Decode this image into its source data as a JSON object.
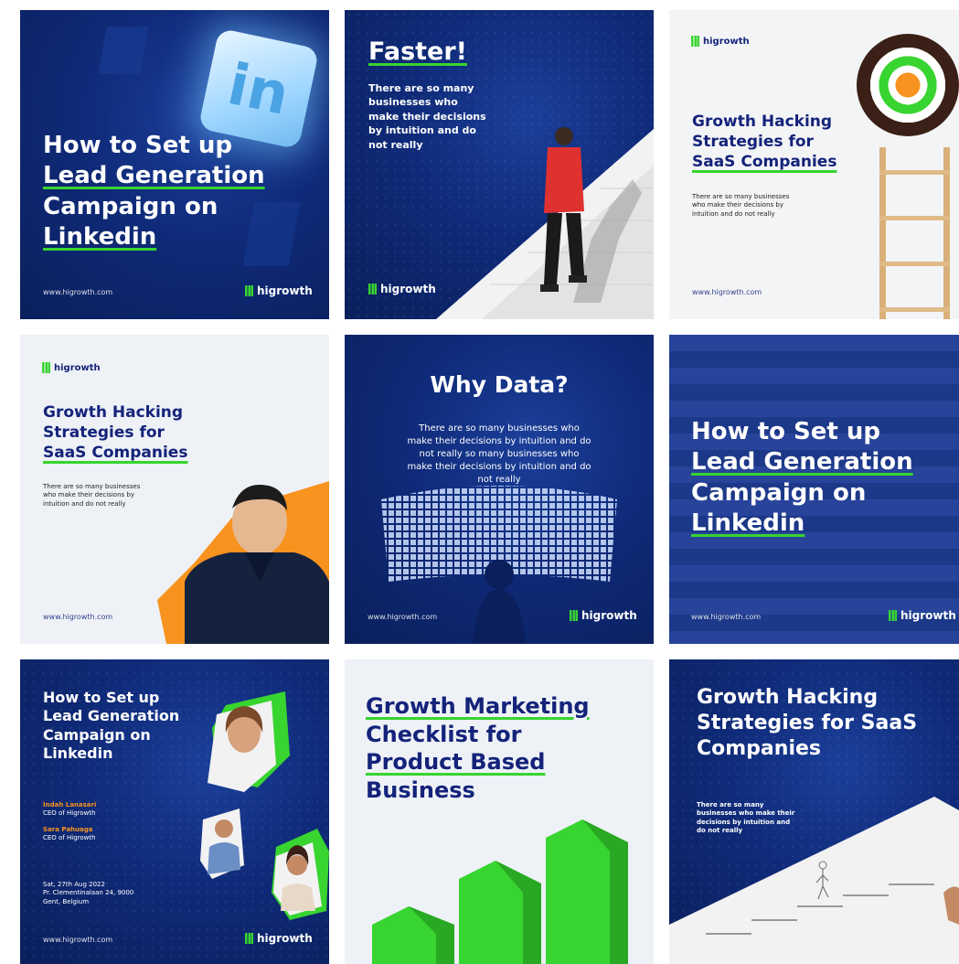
{
  "brand": {
    "name": "higrowth",
    "site": "www.higrowth.com"
  },
  "colors": {
    "navy": "#0f2a78",
    "accent_green": "#38d430",
    "orange": "#f7931e",
    "light_bg": "#eef1f6"
  },
  "tiles": [
    {
      "title_lines": [
        "How to Set up",
        "Lead Generation",
        "Campaign on",
        "Linkedin"
      ],
      "logo_text": "in"
    },
    {
      "heading": "Faster!",
      "body_lines": [
        "There are so many",
        "businesses who",
        "make their decisions",
        "by intuition and do",
        "not really"
      ]
    },
    {
      "title_lines": [
        "Growth Hacking",
        "Strategies for",
        "SaaS Companies"
      ],
      "body_lines": [
        "There are so many businesses",
        "who make their decisions by",
        "intuition and do not really"
      ]
    },
    {
      "title_lines": [
        "Growth Hacking",
        "Strategies for",
        "SaaS Companies"
      ],
      "body_lines": [
        "There are so many businesses",
        "who make their decisions by",
        "intuition and do not really"
      ]
    },
    {
      "heading": "Why Data?",
      "body_lines": [
        "There are so many businesses who",
        "make their decisions by intuition and do",
        "not really so many businesses who",
        "make their decisions by intuition and do",
        "not really"
      ]
    },
    {
      "title_lines": [
        "How to Set up",
        "Lead Generation",
        "Campaign on",
        "Linkedin"
      ]
    },
    {
      "title_lines": [
        "How to Set up",
        "Lead Generation",
        "Campaign on",
        "Linkedin"
      ],
      "speakers": [
        {
          "name": "Indah Lanasari",
          "role": "CEO of Higrowth"
        },
        {
          "name": "Sara Pahuaga",
          "role": "CEO of Higrowth"
        }
      ],
      "event_lines": [
        "Sat, 27th Aug 2022",
        "Pr. Clementinalaan 24, 9000",
        "Gent, Belgium"
      ]
    },
    {
      "title_lines": [
        "Growth Marketing",
        "Checklist for",
        "Product Based",
        "Business"
      ]
    },
    {
      "title_lines": [
        "Growth Hacking",
        "Strategies for SaaS",
        "Companies"
      ],
      "body_lines": [
        "There are so many",
        "businesses who make their",
        "decisions by intuition and",
        "do not really"
      ]
    }
  ]
}
